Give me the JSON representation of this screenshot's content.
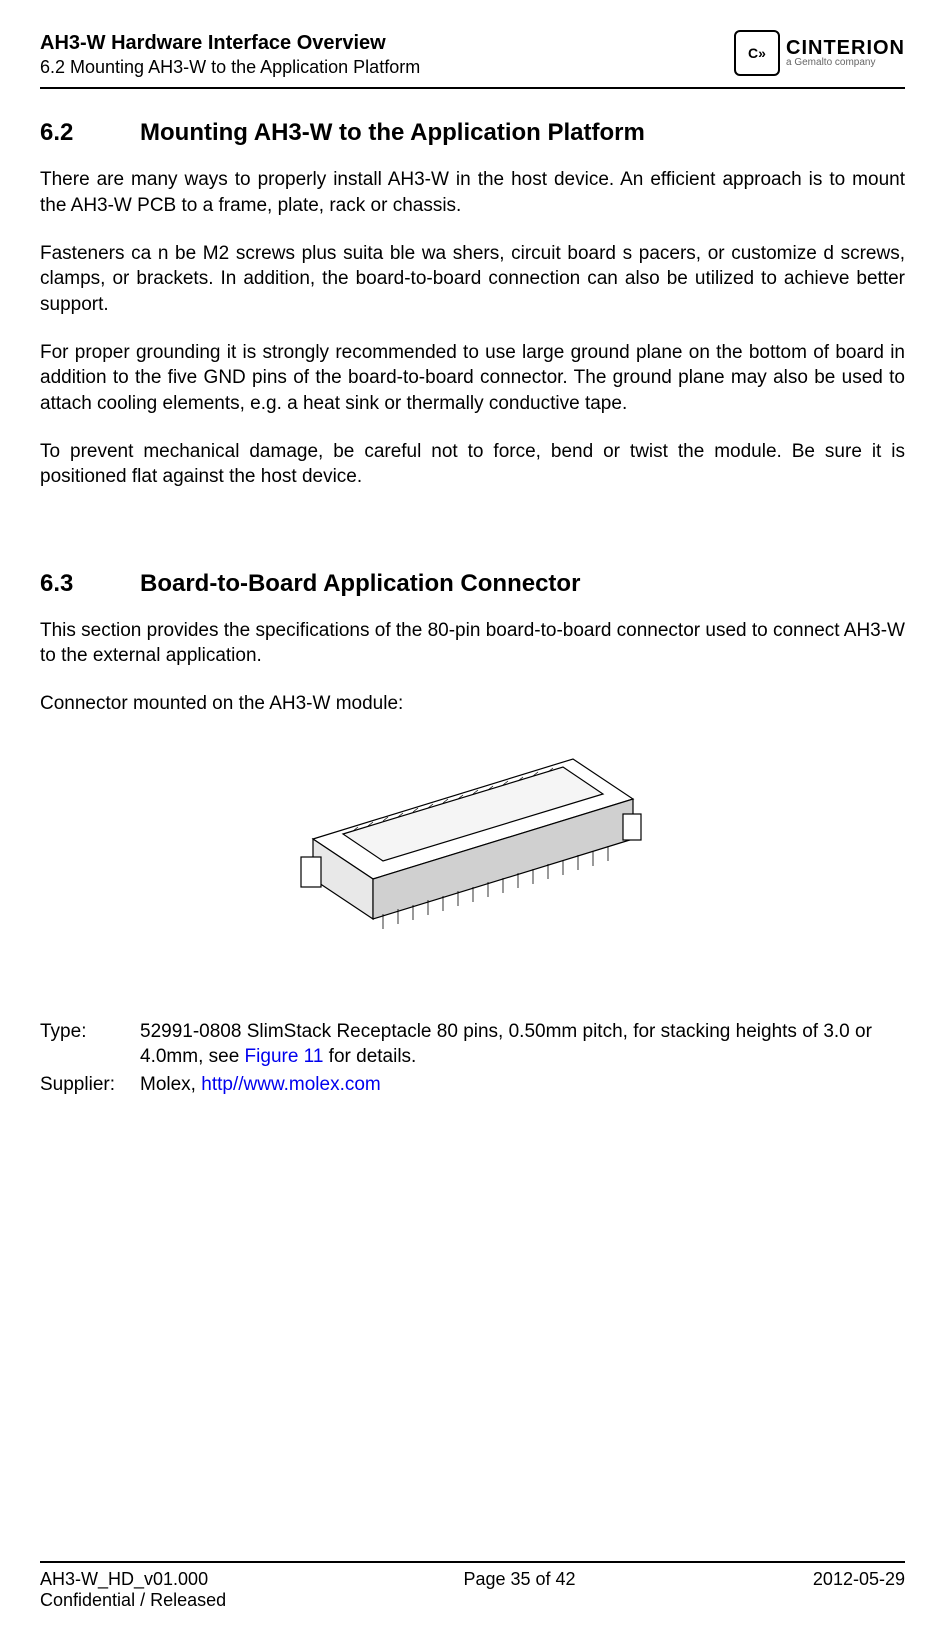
{
  "header": {
    "title": "AH3-W Hardware Interface Overview",
    "subtitle": "6.2 Mounting AH3-W to the Application Platform",
    "logo_brand": "CINTERION",
    "logo_tag": "a Gemalto company",
    "logo_icon": "C»"
  },
  "section1": {
    "num": "6.2",
    "title": "Mounting AH3-W to the Application Platform",
    "p1": "There are many ways to properly install AH3-W in the host device. An efficient approach is to mount the AH3-W PCB to a frame, plate, rack or chassis.",
    "p2": "Fasteners ca n be M2 screws plus suita   ble wa shers, circuit board s  pacers, or customize d screws, clamps, or brackets. In addition, the board-to-board connection can also be utilized to achieve better support.",
    "p3": "For proper grounding it is strongly recommended to use large ground plane on the bottom of board in addition to the five GND pins of the board-to-board connector. The ground plane may also be used to attach cooling elements, e.g. a heat sink or thermally conductive tape.",
    "p4": "To prevent mechanical damage, be careful not to force, bend or twist the module. Be sure it is positioned flat against the host device."
  },
  "section2": {
    "num": "6.3",
    "title": "Board-to-Board Application Connector",
    "p1": "This section provides the specifications of the 80-pin board-to-board connector used to connect AH3-W to the external application.",
    "p2": "Connector mounted on the AH3-W module:",
    "type_label": "Type:",
    "type_value_pre": "52991-0808 SlimStack Receptacle 80 pins, 0.50mm pitch, for stacking heights of 3.0 or 4.0mm, see ",
    "type_link": "Figure 11",
    "type_value_post": " for details.",
    "supplier_label": "Supplier:",
    "supplier_value_pre": "Molex, ",
    "supplier_link": "http//www.molex.com"
  },
  "footer": {
    "doc_id": "AH3-W_HD_v01.000",
    "confidentiality": "Confidential / Released",
    "page": "Page 35 of 42",
    "date": "2012-05-29"
  }
}
